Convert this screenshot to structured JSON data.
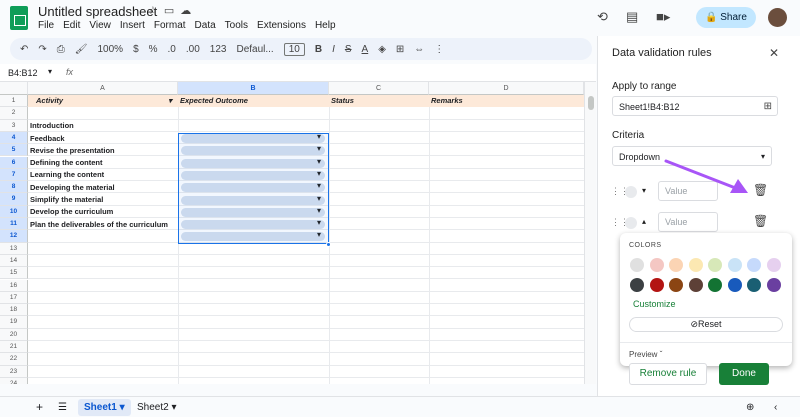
{
  "app": {
    "title": "Untitled spreadsheet",
    "menu": [
      "File",
      "Edit",
      "View",
      "Insert",
      "Format",
      "Data",
      "Tools",
      "Extensions",
      "Help"
    ],
    "share_label": "Share"
  },
  "toolbar": {
    "zoom": "100%",
    "currency": "$",
    "percent": "%",
    "decimals": ".0",
    "decimals_more": ".00",
    "format_number": "123",
    "font": "Defaul...",
    "font_size": "10",
    "bold": "B",
    "italic": "I",
    "strike": "S",
    "text_color": "A"
  },
  "formula_bar": {
    "name_box": "B4:B12",
    "fx": "fx"
  },
  "grid": {
    "columns": [
      "A",
      "B",
      "C",
      "D"
    ],
    "rows": [
      "1",
      "2",
      "3",
      "4",
      "5",
      "6",
      "7",
      "8",
      "9",
      "10",
      "11",
      "12",
      "13",
      "14",
      "15",
      "16",
      "17",
      "18",
      "19",
      "20",
      "21",
      "22",
      "23",
      "24"
    ],
    "header_row": {
      "activity": "Activity",
      "expected_outcome": "Expected Outcome",
      "status": "Status",
      "remarks": "Remarks"
    },
    "section_title": "Introduction",
    "activities": [
      "Feedback",
      "Revise the presentation",
      "Defining the content",
      "Learning the content",
      "Developing the material",
      "Simplify the material",
      "Develop the curriculum",
      "Plan the deliverables of the curriculum"
    ]
  },
  "sheets": {
    "tabs": [
      "Sheet1",
      "Sheet2"
    ],
    "active": "Sheet1"
  },
  "panel": {
    "title": "Data validation rules",
    "apply_range_label": "Apply to range",
    "range_value": "Sheet1!B4:B12",
    "criteria_label": "Criteria",
    "criteria_value": "Dropdown",
    "value_placeholder_1": "Value",
    "value_placeholder_2": "Value",
    "colors_label": "COLORS",
    "customize_label": "Customize",
    "reset_label": "Reset",
    "preview_label": "Preview",
    "remove_rule_label": "Remove rule",
    "done_label": "Done"
  },
  "palette": {
    "light": [
      "#e0e0e0",
      "#f4c7c3",
      "#fbd4b4",
      "#fce8b2",
      "#d7e8b8",
      "#c9e3f7",
      "#c6dafc",
      "#e6d0ef"
    ],
    "dark": [
      "#3c4043",
      "#b31412",
      "#8b4513",
      "#5d4037",
      "#137333",
      "#185abc",
      "#1a5f73",
      "#6a3fa0"
    ],
    "accent_green": "#188038",
    "selection_blue": "#1a73e8",
    "annotation_arrow": "#a855f7"
  }
}
